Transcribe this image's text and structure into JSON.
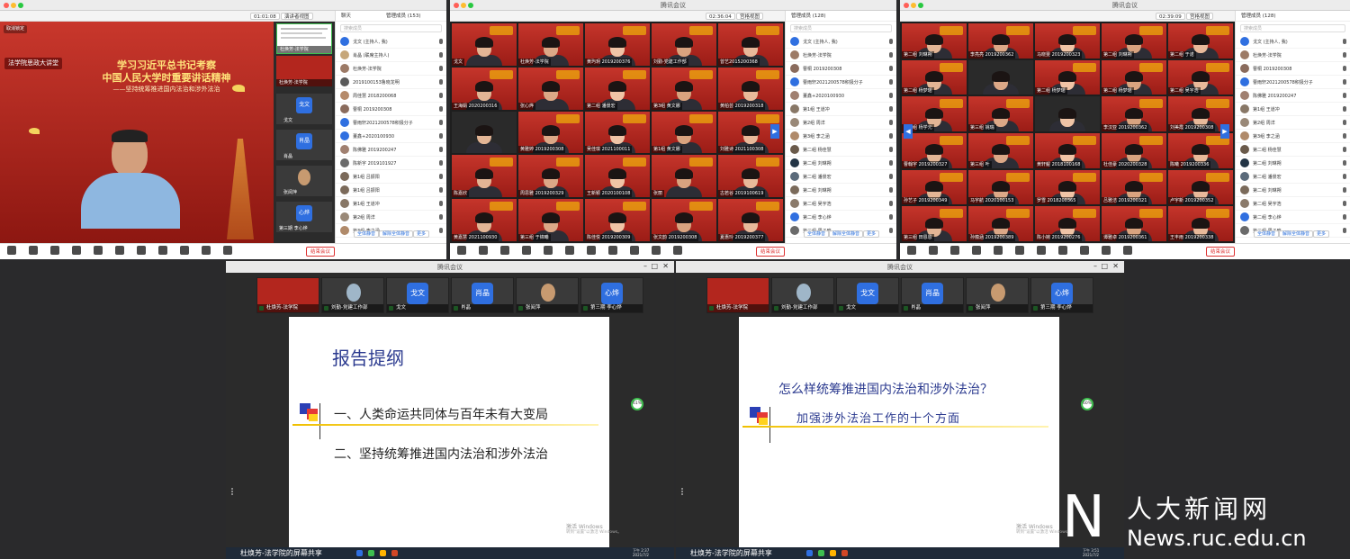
{
  "panel1": {
    "timer": "01:01:08",
    "view_label": "演讲者视图",
    "chat_label": "聊天",
    "members_label": "管理成员 (153)",
    "search_placeholder": "搜索成员",
    "banner_title_line1": "学习习近平总书记考察",
    "banner_title_line2": "中国人民大学时重要讲话精神",
    "banner_subtitle": "——坚持统筹推进国内法治和涉外法治",
    "banner_logo": "法学院思政大讲堂",
    "lock_label": "取消锁定",
    "speaker_name": "杜焕芳-法学院",
    "thumbs": [
      {
        "label": "杜焕芳-法学院"
      },
      {
        "label": "戈文",
        "avatar": "戈文"
      },
      {
        "label": "肖晶",
        "avatar": "肖晶"
      },
      {
        "label": "张阅萍"
      },
      {
        "label": "第三期 李心烨",
        "avatar": "心烨"
      }
    ],
    "participants": [
      {
        "name": "戈文 (主持人, 我)",
        "color": "#2f6fe0"
      },
      {
        "name": "肖晶 (联席主持人)",
        "color": "#c6a77a"
      },
      {
        "name": "杜焕芳-法学院",
        "color": "#9c7a66"
      },
      {
        "name": "2019100153鲁晓龙明",
        "color": "#5a5a5a"
      },
      {
        "name": "周佳慧 2018200068",
        "color": "#b58a6a"
      },
      {
        "name": "曹桐 2019200308",
        "color": "#8a6b5c"
      },
      {
        "name": "曹雨轩2021200578积极分子",
        "color": "#2f6fe0"
      },
      {
        "name": "董鑫+2020100930",
        "color": "#2f6fe0"
      },
      {
        "name": "陈佛雅 2019200247",
        "color": "#a08070"
      },
      {
        "name": "陈新宇 2019101927",
        "color": "#6a6a6a"
      },
      {
        "name": "第1组 吕振阳",
        "color": "#7b6a5a"
      },
      {
        "name": "第1组 吕振阳",
        "color": "#7b6a5a"
      },
      {
        "name": "第1组 王道冲",
        "color": "#887766"
      },
      {
        "name": "第2组 周洋",
        "color": "#998877"
      },
      {
        "name": "第3组 李之涵",
        "color": "#b08a6a"
      }
    ],
    "bottom_buttons": [
      "解除静音",
      "开启视频",
      "共享屏幕",
      "管理成员(153)",
      "安全",
      "邀请",
      "聊天",
      "录制",
      "分组讨论",
      "应用",
      "设置"
    ],
    "end_button": "结束会议",
    "mute_all": "全体静音",
    "unmute_all": "解除全体静音",
    "more": "更多"
  },
  "panel2": {
    "timer": "02:36:04",
    "view_label": "宫格视图",
    "window_title": "腾讯会议",
    "members_label": "管理成员 (128)",
    "search_placeholder": "搜索成员",
    "tiles": [
      "戈文",
      "杜焕芳-法学院",
      "黄玙玥 2019200376",
      "刘勤-党建工作部",
      "曾艺2015200368",
      "王海娟 2020200316",
      "张心烨",
      "第二组 潘景宏",
      "第3组 黄文娜",
      "黄柏芸 2019200318",
      "",
      "黄雅婷 2019200308",
      "吴佳琪 2021100011",
      "第1组 黄文娜",
      "刘雅诗 2021100308",
      "陈嘉欣",
      "周思雅 2019200329",
      "王新颖 2020100108",
      "张丽",
      "古若谷 2019100619",
      "黄嘉慧 2021100930",
      "第三组 于锦曦",
      "陈佳悦 2019200309",
      "张文韵 2019200308",
      "夏惠玲 2019200377"
    ],
    "participants": [
      "戈文 (主持人, 我)",
      "杜焕芳-法学院",
      "曹桐 2019200308",
      "曹雨轩2021200578积极分子",
      "董鑫+2020100930",
      "第1组 王道冲",
      "第2组 周洋",
      "第3组 李之涵",
      "第二组 杨佳慧",
      "第二组 刘琳朔",
      "第二组 潘景宏",
      "第二组 刘琳朔",
      "第二组 吴宇浩",
      "第二组 李心烨",
      "第二组 周子晗"
    ],
    "end_button": "结束会议",
    "mute_all": "全体静音",
    "unmute_all": "解除全体静音",
    "more": "更多"
  },
  "panel3": {
    "timer": "02:39:09",
    "view_label": "宫格视图",
    "window_title": "腾讯会议",
    "members_label": "管理成员 (128)",
    "search_placeholder": "搜索成员",
    "tiles": [
      "第二组 刘琳朔",
      "李亮亮 2019200362",
      "马晓雯 2019200323",
      "第二组 刘琳朔",
      "第二组 于诺",
      "第二组 杨梦瑶",
      "",
      "第二组 杨梦瑶",
      "第二组 杨梦瑶",
      "第二组 吴宇浩",
      "第二组 杨学元",
      "第三组 姚瑞",
      "",
      "李汉亚 2019200362",
      "刘美霞 2019200308",
      "曹翰宇 2019200327",
      "第三组 叶",
      "黄轩鲲 2018100168",
      "杜佳豪 2020200328",
      "陈曦 2019200336",
      "孙艺子 2019200349",
      "马宇航 2020100153",
      "罗雪 2018200365",
      "吕雅洁 2019200321",
      "卢宇新 2019200352",
      "第三组 田恩恩",
      "孙蕴涵 2019200389",
      "陈小婉 2019200276",
      "谭雅卓 2019200361",
      "王丰雨 2019200338"
    ],
    "participants": [
      "戈文 (主持人, 我)",
      "杜焕芳-法学院",
      "曹桐 2019200308",
      "曹雨轩2021200578积极分子",
      "陈佛雅 2019200247",
      "第1组 王道冲",
      "第2组 周洋",
      "第3组 李之涵",
      "第二组 杨佳慧",
      "第二组 刘琳朔",
      "第二组 潘景宏",
      "第二组 刘琳朔",
      "第二组 吴宇浩",
      "第二组 李心烨",
      "第二组 周子晗"
    ],
    "end_button": "结束会议",
    "mute_all": "全体静音",
    "unmute_all": "解除全体静音",
    "more": "更多"
  },
  "panel4": {
    "window_title": "腾讯会议",
    "slide_title": "报告提纲",
    "outline": [
      "一、人类命运共同体与百年未有大变局",
      "二、坚持统筹推进国内法治和涉外法治"
    ],
    "share_label": "杜焕芳-法学院的屏幕共享",
    "watermark": "激活 Windows",
    "watermark_sub": "转到\"设置\"以激活 Windows。",
    "clock": "下午 2:37\n2021/7/2",
    "percent": "61%"
  },
  "panel5": {
    "window_title": "腾讯会议",
    "question": "怎么样统筹推进国内法治和涉外法治？",
    "subline": "加强涉外法治工作的十个方面",
    "share_label": "杜焕芳-法学院的屏幕共享",
    "watermark": "激活 Windows",
    "watermark_sub": "转到\"设置\"以激活 Windows。",
    "clock": "下午 3:51\n2021/7/2",
    "percent": "60%"
  },
  "thumb_row": [
    {
      "label": "杜焕芳-法学院"
    },
    {
      "label": "刘勤-党建工作部"
    },
    {
      "label": "戈文",
      "avatar": "戈文"
    },
    {
      "label": "肖晶",
      "avatar": "肖晶"
    },
    {
      "label": "张阅萍"
    },
    {
      "label": "第三期 李心烨",
      "avatar": "心烨"
    }
  ],
  "logo": {
    "cn": "人大新闻网",
    "url": "News.ruc.edu.cn"
  },
  "colors": {
    "accent_blue": "#2f6fe0",
    "end_red": "#d33333",
    "banner_red": "#b3261e",
    "slide_blue": "#2b3a8f"
  }
}
